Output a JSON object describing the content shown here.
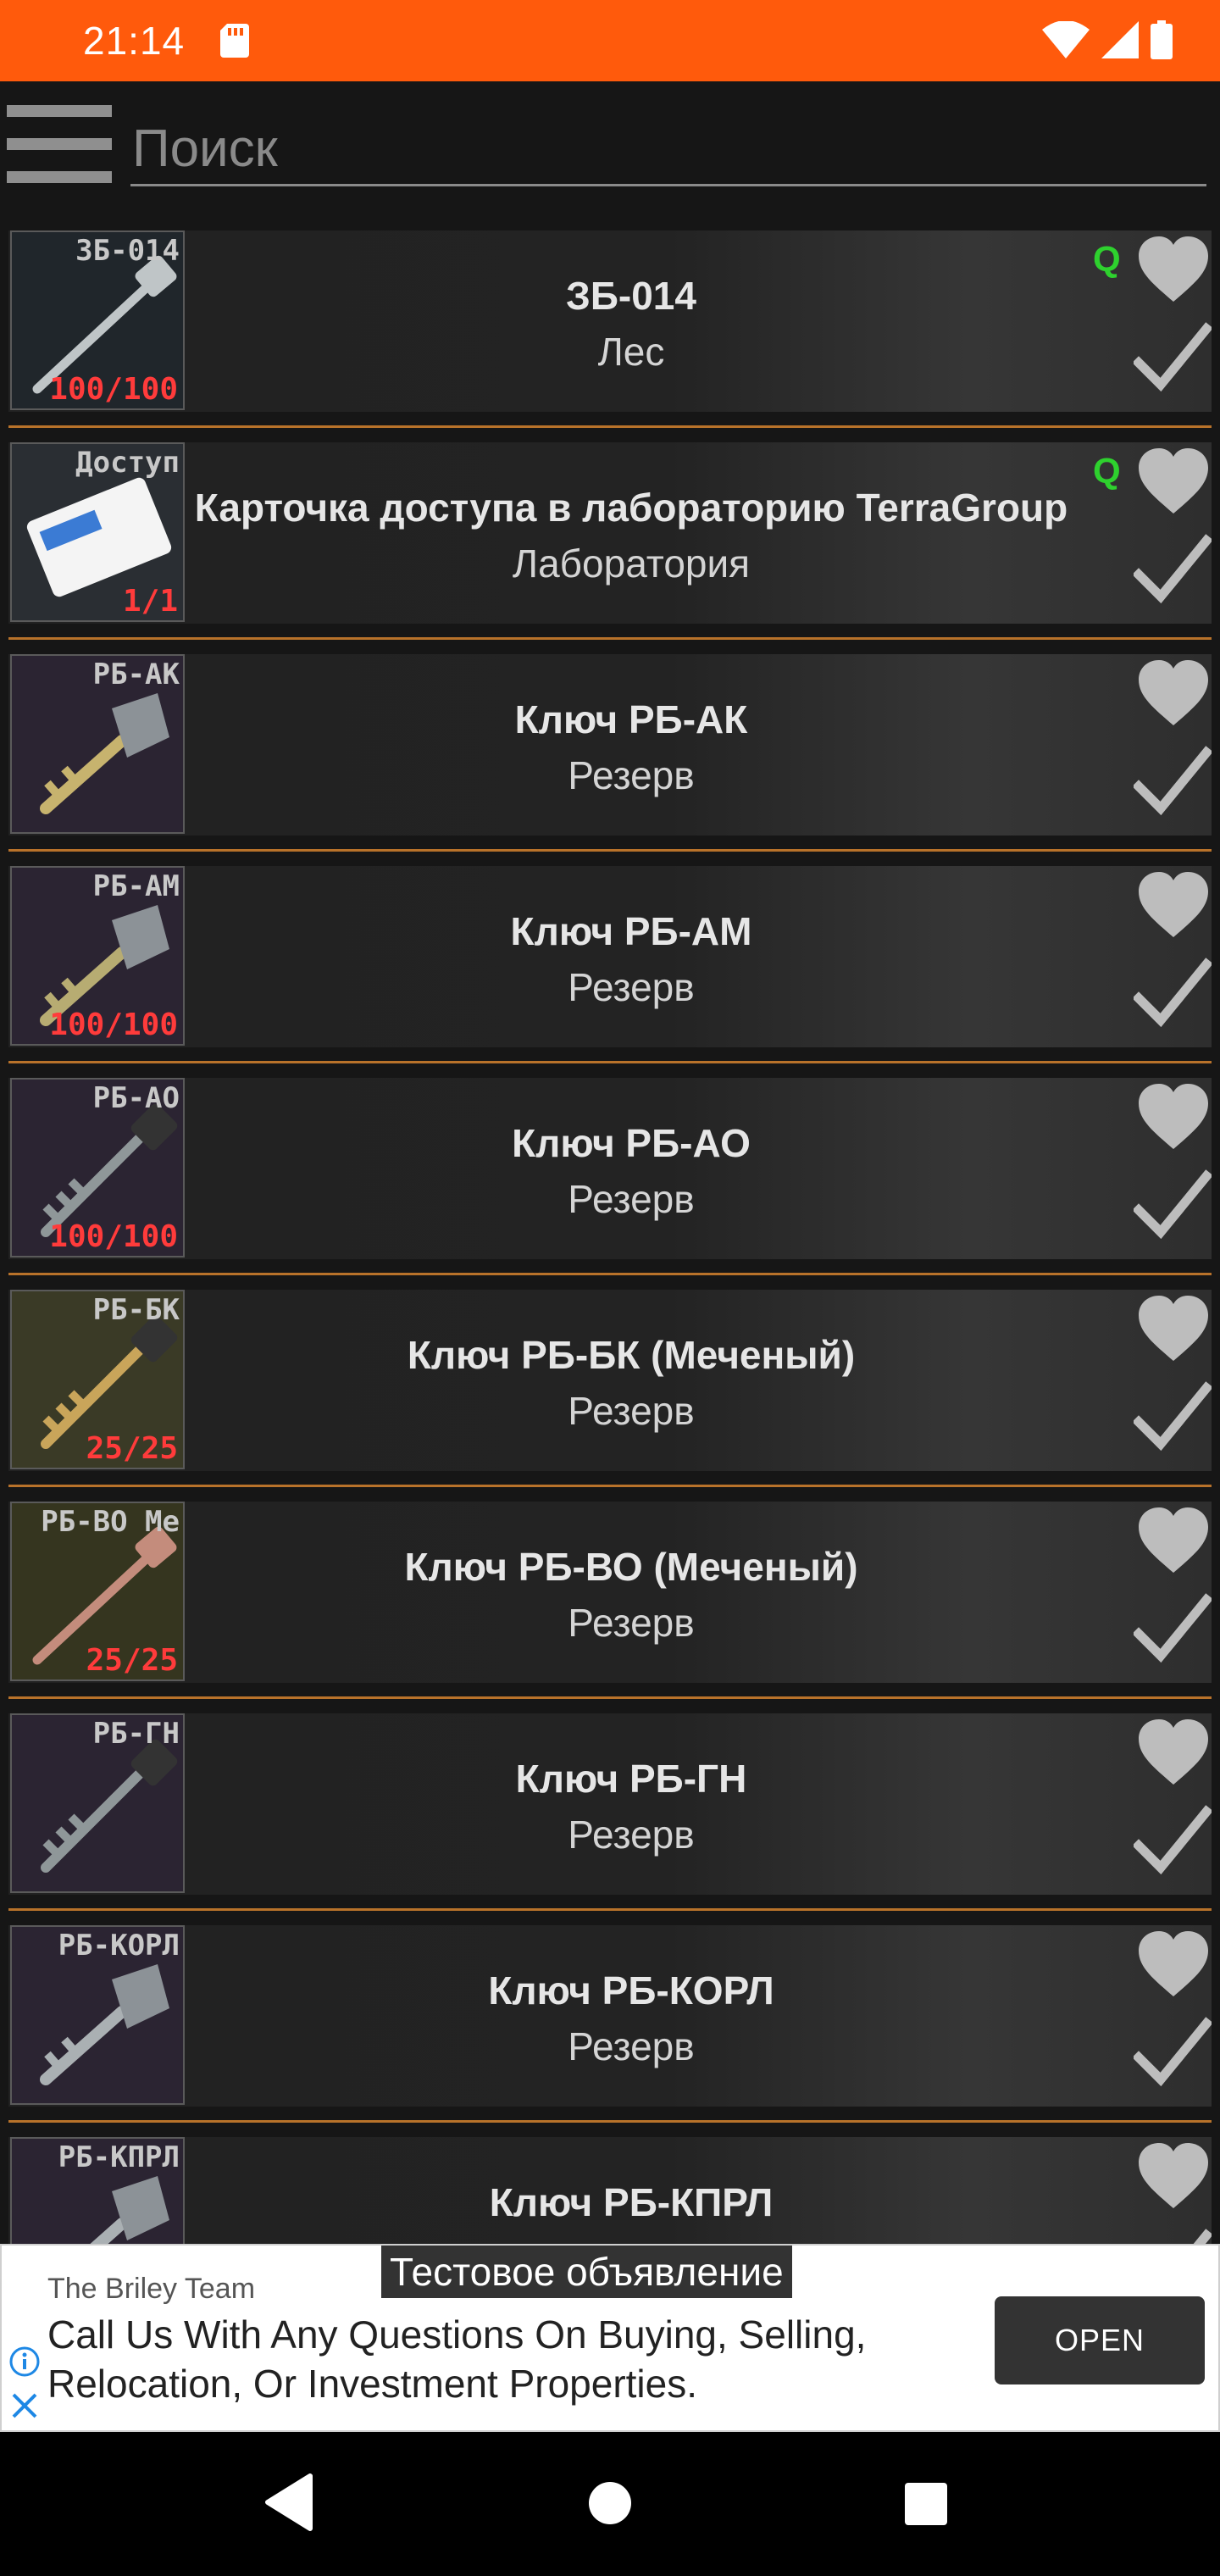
{
  "status_bar": {
    "time": "21:14",
    "icons": [
      "sd-card-icon",
      "wifi-icon",
      "signal-icon",
      "battery-icon"
    ]
  },
  "search": {
    "placeholder": "Поиск",
    "value": ""
  },
  "colors": {
    "status_bar": "#ff5a0c",
    "separator": "#b8722a",
    "quest_badge": "#2ed12e",
    "thumb_count": "#ff3b3b"
  },
  "items": [
    {
      "name": "ЗБ-014",
      "location": "Лес",
      "thumb_code": "ЗБ-014",
      "thumb_count": "100/100",
      "quest": "Q"
    },
    {
      "name": "Карточка доступа в лабораторию TerraGroup",
      "location": "Лаборатория",
      "thumb_code": "Доступ",
      "thumb_count": "1/1",
      "quest": "Q"
    },
    {
      "name": "Ключ РБ-АК",
      "location": "Резерв",
      "thumb_code": "РБ-АК",
      "thumb_count": "",
      "quest": ""
    },
    {
      "name": "Ключ РБ-АМ",
      "location": "Резерв",
      "thumb_code": "РБ-АМ",
      "thumb_count": "100/100",
      "quest": ""
    },
    {
      "name": "Ключ РБ-АО",
      "location": "Резерв",
      "thumb_code": "РБ-АО",
      "thumb_count": "100/100",
      "quest": ""
    },
    {
      "name": "Ключ РБ-БК (Меченый)",
      "location": "Резерв",
      "thumb_code": "РБ-БК",
      "thumb_count": "25/25",
      "quest": ""
    },
    {
      "name": "Ключ РБ-ВО (Меченый)",
      "location": "Резерв",
      "thumb_code": "РБ-ВО Ме",
      "thumb_count": "25/25",
      "quest": ""
    },
    {
      "name": "Ключ РБ-ГН",
      "location": "Резерв",
      "thumb_code": "РБ-ГН",
      "thumb_count": "",
      "quest": ""
    },
    {
      "name": "Ключ РБ-КОРЛ",
      "location": "Резерв",
      "thumb_code": "РБ-КОРЛ",
      "thumb_count": "",
      "quest": ""
    },
    {
      "name": "Ключ РБ-КПРЛ",
      "location": "",
      "thumb_code": "РБ-КПРЛ",
      "thumb_count": "",
      "quest": ""
    }
  ],
  "ad": {
    "label": "Тестовое объявление",
    "advertiser": "The Briley Team",
    "body": "Call Us With Any Questions On Buying, Selling, Relocation, Or Investment Properties.",
    "cta": "OPEN"
  },
  "navbar": {
    "icons": [
      "back-icon",
      "home-icon",
      "recents-icon"
    ]
  }
}
